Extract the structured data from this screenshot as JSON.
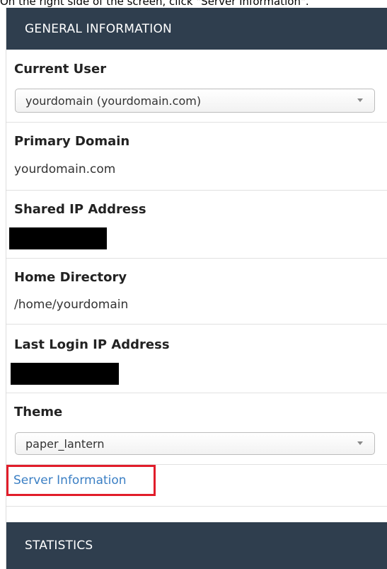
{
  "caption": "On the right side of the screen, click \"Server Information\".",
  "general": {
    "header": "GENERAL INFORMATION",
    "current_user": {
      "label": "Current User",
      "selected": "yourdomain (yourdomain.com)"
    },
    "primary_domain": {
      "label": "Primary Domain",
      "value": "yourdomain.com"
    },
    "shared_ip": {
      "label": "Shared IP Address"
    },
    "home_directory": {
      "label": "Home Directory",
      "value": "/home/yourdomain"
    },
    "last_login_ip": {
      "label": "Last Login IP Address"
    },
    "theme": {
      "label": "Theme",
      "selected": "paper_lantern"
    },
    "server_info_link": "Server Information"
  },
  "statistics": {
    "header": "STATISTICS"
  },
  "colors": {
    "header_bg": "#2f3e4e",
    "link": "#3b7fc4",
    "highlight_border": "#e11d2a"
  }
}
